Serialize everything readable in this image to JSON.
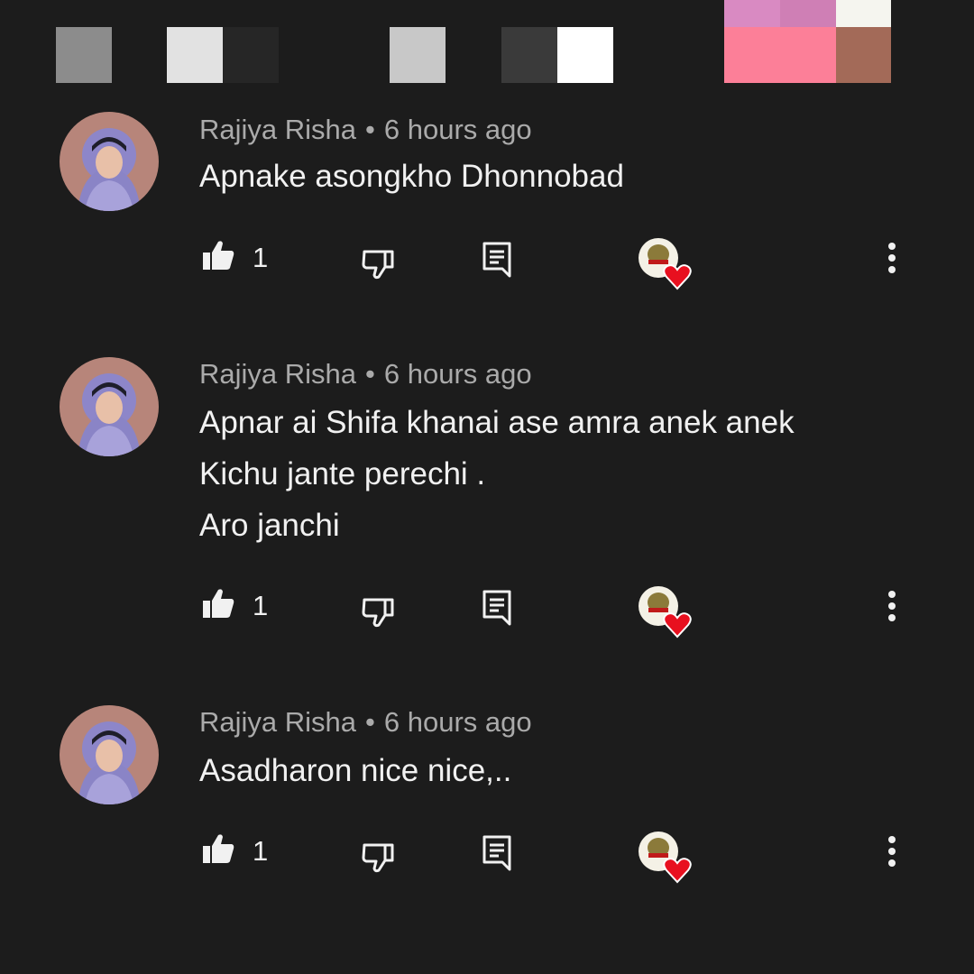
{
  "comments": [
    {
      "author": "Rajiya Risha",
      "separator": "•",
      "time": "6 hours ago",
      "lines": [
        "Apnake asongkho Dhonnobad"
      ],
      "likes": "1"
    },
    {
      "author": "Rajiya Risha",
      "separator": "•",
      "time": "6 hours ago",
      "lines": [
        "Apnar ai Shifa khanai ase amra anek anek",
        "Kichu jante perechi .",
        "Aro janchi"
      ],
      "likes": "1"
    },
    {
      "author": "Rajiya Risha",
      "separator": "•",
      "time": "6 hours ago",
      "lines": [
        "Asadharon nice nice,.."
      ],
      "likes": "1"
    }
  ],
  "icons": {
    "like": "thumb-up-icon",
    "dislike": "thumb-down-icon",
    "reply": "reply-icon",
    "hearted": "creator-heart-badge",
    "more": "more-vert-icon"
  },
  "colors": {
    "background": "#1c1c1c",
    "meta_text": "#aaaaaa",
    "body_text": "#f1f1f1",
    "heart": "#e8101f"
  }
}
